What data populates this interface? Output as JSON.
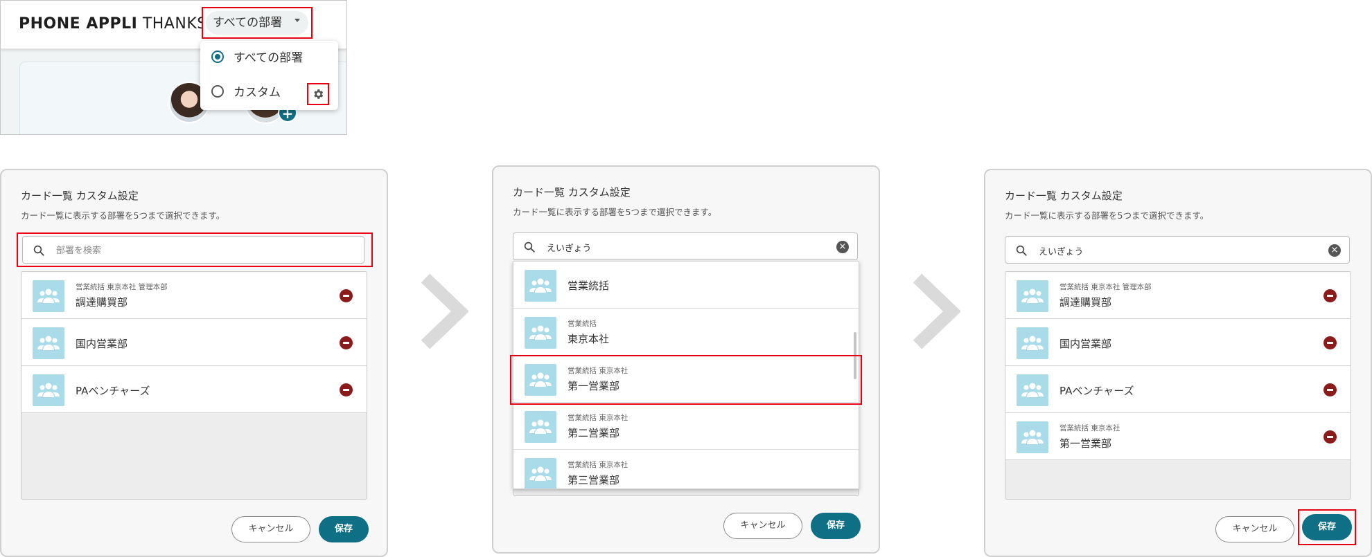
{
  "header": {
    "brand_bold": "PHONE APPLI",
    "brand_light": "THANKS",
    "dept_button_label": "すべての部署",
    "menu": {
      "option_all": "すべての部署",
      "option_custom": "カスタム"
    }
  },
  "dialog": {
    "title": "カード一覧 カスタム設定",
    "subtitle": "カード一覧に表示する部署を5つまで選択できます。",
    "search_placeholder": "部署を検索",
    "search_value": "えいぎょう",
    "cancel_label": "キャンセル",
    "save_label": "保存"
  },
  "panel1": {
    "rows": [
      {
        "path": "営業統括 東京本社 管理本部",
        "name": "調達購買部"
      },
      {
        "path": "",
        "name": "国内営業部"
      },
      {
        "path": "",
        "name": "PAベンチャーズ"
      }
    ]
  },
  "panel2": {
    "results": [
      {
        "path": "",
        "name": "営業統括"
      },
      {
        "path": "営業統括",
        "name": "東京本社"
      },
      {
        "path": "営業統括 東京本社",
        "name": "第一営業部"
      },
      {
        "path": "営業統括 東京本社",
        "name": "第二営業部"
      },
      {
        "path": "営業統括 東京本社",
        "name": "第三営業部"
      }
    ]
  },
  "panel3": {
    "rows": [
      {
        "path": "営業統括 東京本社 管理本部",
        "name": "調達購買部"
      },
      {
        "path": "",
        "name": "国内営業部"
      },
      {
        "path": "",
        "name": "PAベンチャーズ"
      },
      {
        "path": "営業統括 東京本社",
        "name": "第一営業部"
      }
    ]
  },
  "icons": {
    "group": "group-icon",
    "remove": "remove-circle-icon",
    "search": "search-icon",
    "clear": "clear-icon",
    "gear": "gear-icon",
    "arrow": "chevron-right-icon"
  },
  "colors": {
    "accent": "#0f6f85",
    "highlight": "#e60012",
    "remove": "#8b1a1a",
    "group_icon_bg": "#a9dbe8"
  }
}
